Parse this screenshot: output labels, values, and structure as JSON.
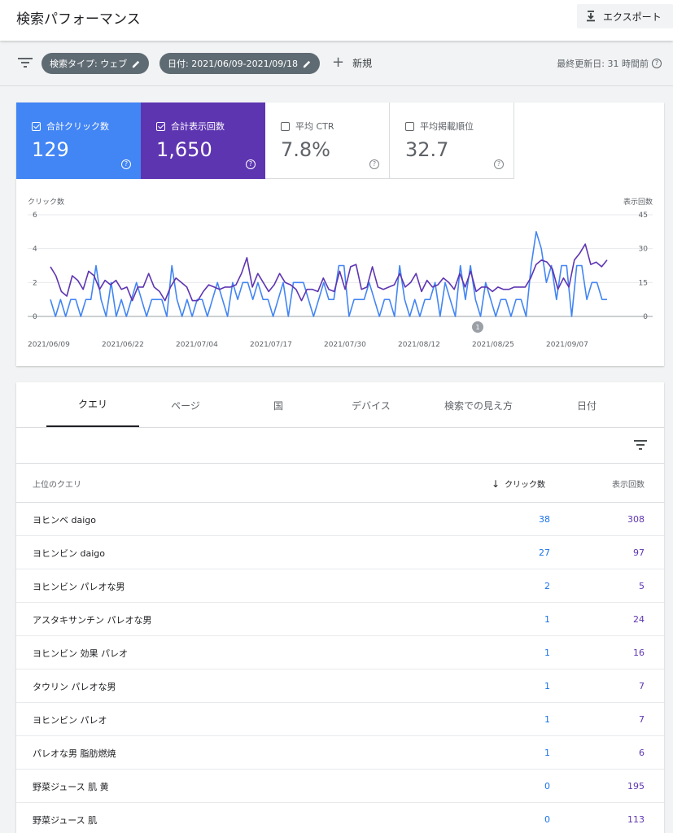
{
  "header": {
    "title": "検索パフォーマンス",
    "export_label": "エクスポート"
  },
  "filters": {
    "chips": [
      {
        "label": "検索タイプ: ウェブ"
      },
      {
        "label": "日付: 2021/06/09-2021/09/18"
      }
    ],
    "add_label": "新規",
    "updated": "最終更新日: 31 時間前"
  },
  "metrics": {
    "clicks": {
      "label": "合計クリック数",
      "value": "129",
      "checked": true,
      "color": "#4285f4"
    },
    "impressions": {
      "label": "合計表示回数",
      "value": "1,650",
      "checked": true,
      "color": "#5e35b1"
    },
    "ctr": {
      "label": "平均 CTR",
      "value": "7.8%",
      "checked": false
    },
    "position": {
      "label": "平均掲載順位",
      "value": "32.7",
      "checked": false
    }
  },
  "chart_data": {
    "type": "line",
    "left_axis_label": "クリック数",
    "right_axis_label": "表示回数",
    "left_ticks": [
      "6",
      "4",
      "2",
      "0"
    ],
    "right_ticks": [
      "45",
      "30",
      "15",
      "0"
    ],
    "ylim_left": [
      0,
      6
    ],
    "ylim_right": [
      0,
      45
    ],
    "x_ticks": [
      "2021/06/09",
      "2021/06/22",
      "2021/07/04",
      "2021/07/17",
      "2021/07/30",
      "2021/08/12",
      "2021/08/25",
      "2021/09/07"
    ],
    "annotation": "1",
    "series": [
      {
        "name": "クリック数",
        "axis": "left",
        "color": "#4285f4",
        "values": [
          1,
          0,
          1,
          0,
          1,
          1,
          0,
          1,
          1,
          3,
          1,
          0,
          2,
          0,
          1,
          0,
          1,
          2,
          1,
          0,
          1,
          1,
          1,
          0,
          3,
          1,
          0,
          1,
          0,
          1,
          1,
          0,
          1,
          2,
          1,
          0,
          2,
          1,
          2,
          2,
          1,
          2,
          1,
          1,
          0,
          1,
          2,
          0,
          2,
          2,
          2,
          1,
          0,
          1,
          2,
          1,
          1,
          3,
          3,
          0,
          1,
          1,
          1,
          2,
          1,
          0,
          1,
          1,
          0,
          3,
          1,
          0,
          1,
          0,
          1,
          1,
          2,
          0,
          2,
          1,
          0,
          3,
          1,
          3,
          1,
          0,
          2,
          1,
          0,
          1,
          1,
          0,
          1,
          1,
          0,
          3,
          5,
          4,
          2,
          3,
          1,
          3,
          3,
          0,
          3,
          3,
          1,
          2,
          2,
          1,
          1
        ]
      },
      {
        "name": "表示回数",
        "axis": "right",
        "color": "#5e35b1",
        "values": [
          22,
          18,
          11,
          9,
          18,
          16,
          12,
          20,
          18,
          12,
          16,
          14,
          16,
          12,
          13,
          7,
          13,
          13,
          19,
          13,
          11,
          7,
          13,
          17,
          15,
          13,
          7,
          7,
          11,
          14,
          13,
          12,
          13,
          13,
          14,
          19,
          26,
          13,
          19,
          15,
          11,
          14,
          19,
          15,
          14,
          12,
          7,
          12,
          12,
          11,
          17,
          12,
          11,
          20,
          12,
          22,
          23,
          12,
          13,
          22,
          13,
          12,
          13,
          14,
          19,
          13,
          15,
          19,
          11,
          16,
          13,
          14,
          17,
          15,
          12,
          19,
          13,
          20,
          11,
          13,
          13,
          11,
          13,
          12,
          12,
          13,
          13,
          13,
          17,
          23,
          25,
          24,
          21,
          12,
          17,
          13,
          25,
          28,
          32,
          23,
          24,
          22,
          25
        ]
      }
    ]
  },
  "tabs": [
    {
      "label": "クエリ",
      "active": true
    },
    {
      "label": "ページ",
      "active": false
    },
    {
      "label": "国",
      "active": false
    },
    {
      "label": "デバイス",
      "active": false
    },
    {
      "label": "検索での見え方",
      "active": false
    },
    {
      "label": "日付",
      "active": false
    }
  ],
  "table": {
    "headers": {
      "query": "上位のクエリ",
      "clicks": "クリック数",
      "impressions": "表示回数"
    },
    "rows": [
      {
        "query": "ヨヒンベ daigo",
        "clicks": "38",
        "impressions": "308"
      },
      {
        "query": "ヨヒンビン daigo",
        "clicks": "27",
        "impressions": "97"
      },
      {
        "query": "ヨヒンビン パレオな男",
        "clicks": "2",
        "impressions": "5"
      },
      {
        "query": "アスタキサンチン パレオな男",
        "clicks": "1",
        "impressions": "24"
      },
      {
        "query": "ヨヒンビン 効果 パレオ",
        "clicks": "1",
        "impressions": "16"
      },
      {
        "query": "タウリン パレオな男",
        "clicks": "1",
        "impressions": "7"
      },
      {
        "query": "ヨヒンビン パレオ",
        "clicks": "1",
        "impressions": "7"
      },
      {
        "query": "パレオな男 脂肪燃焼",
        "clicks": "1",
        "impressions": "6"
      },
      {
        "query": "野菜ジュース 肌 黄",
        "clicks": "0",
        "impressions": "195"
      },
      {
        "query": "野菜ジュース 肌",
        "clicks": "0",
        "impressions": "113"
      }
    ]
  }
}
